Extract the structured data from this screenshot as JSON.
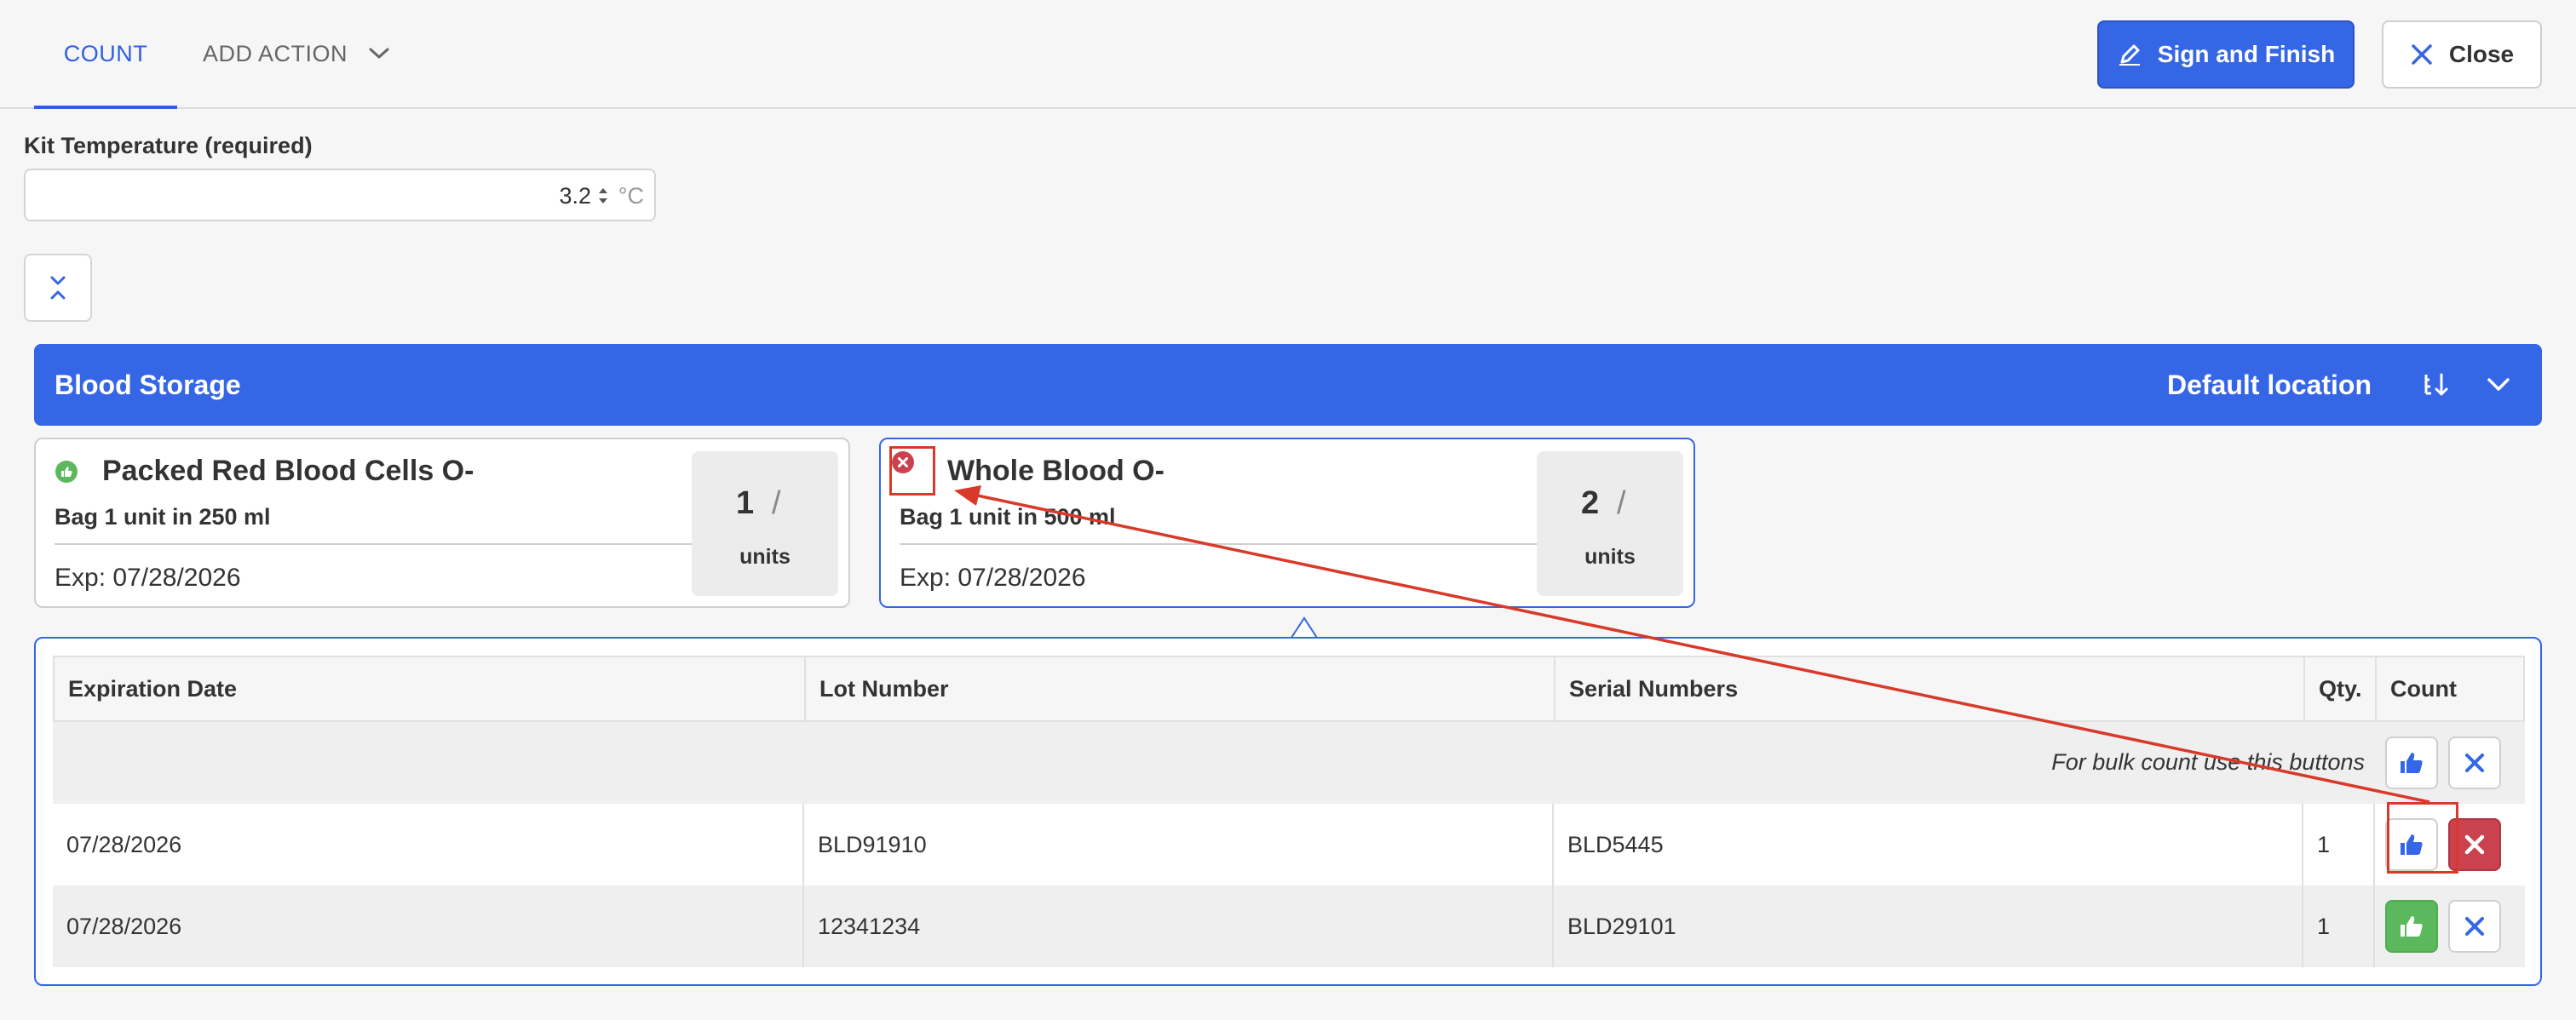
{
  "tabs": {
    "count": "COUNT",
    "add_action": "ADD ACTION"
  },
  "actions": {
    "sign_finish": "Sign and Finish",
    "close": "Close"
  },
  "temperature": {
    "label": "Kit Temperature (required)",
    "value": "3.2",
    "unit": "°C"
  },
  "section": {
    "title": "Blood Storage",
    "location": "Default location"
  },
  "cards": [
    {
      "name": "Packed Red Blood Cells O-",
      "description": "Bag 1 unit in 250 ml",
      "expiration": "Exp: 07/28/2026",
      "quantity": "1",
      "slash": "/",
      "unit": "units",
      "status": "counted",
      "status_color": "#5cb85c"
    },
    {
      "name": "Whole Blood O-",
      "description": "Bag 1 unit in 500 ml",
      "expiration": "Exp: 07/28/2026",
      "quantity": "2",
      "slash": "/",
      "unit": "units",
      "status": "rejected",
      "status_color": "#c9424e"
    }
  ],
  "table": {
    "columns": [
      "Expiration Date",
      "Lot Number",
      "Serial Numbers",
      "Qty.",
      "Count"
    ],
    "bulk_hint": "For bulk count use this buttons",
    "rows": [
      {
        "expiration": "07/28/2026",
        "lot": "BLD91910",
        "serial": "BLD5445",
        "qty": "1",
        "count_state": "rejected"
      },
      {
        "expiration": "07/28/2026",
        "lot": "12341234",
        "serial": "BLD29101",
        "qty": "1",
        "count_state": "approved"
      }
    ]
  },
  "colors": {
    "primary": "#3566e5",
    "success": "#5cb85c",
    "danger": "#c9424e",
    "annotation": "#d83a2a"
  }
}
